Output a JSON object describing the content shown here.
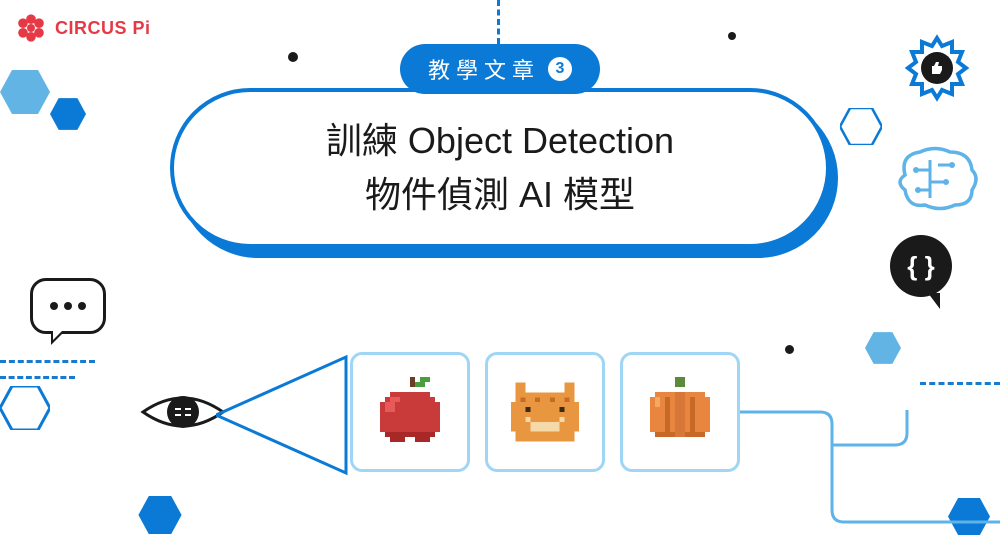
{
  "logo": {
    "text": "CIRCUS Pi"
  },
  "badge": {
    "label": "教學文章",
    "number": "3"
  },
  "title": {
    "line1": "訓練 Object Detection",
    "line2": "物件偵測 AI 模型"
  },
  "code_bubble": {
    "symbol": "{ }"
  },
  "colors": {
    "primary_blue": "#0a7ad6",
    "light_blue": "#5eb3e8",
    "pale_blue": "#9fd5f5",
    "red": "#e63946",
    "dark": "#1a1a1a"
  },
  "pixel_cards": [
    {
      "name": "apple"
    },
    {
      "name": "cat"
    },
    {
      "name": "pumpkin"
    }
  ]
}
